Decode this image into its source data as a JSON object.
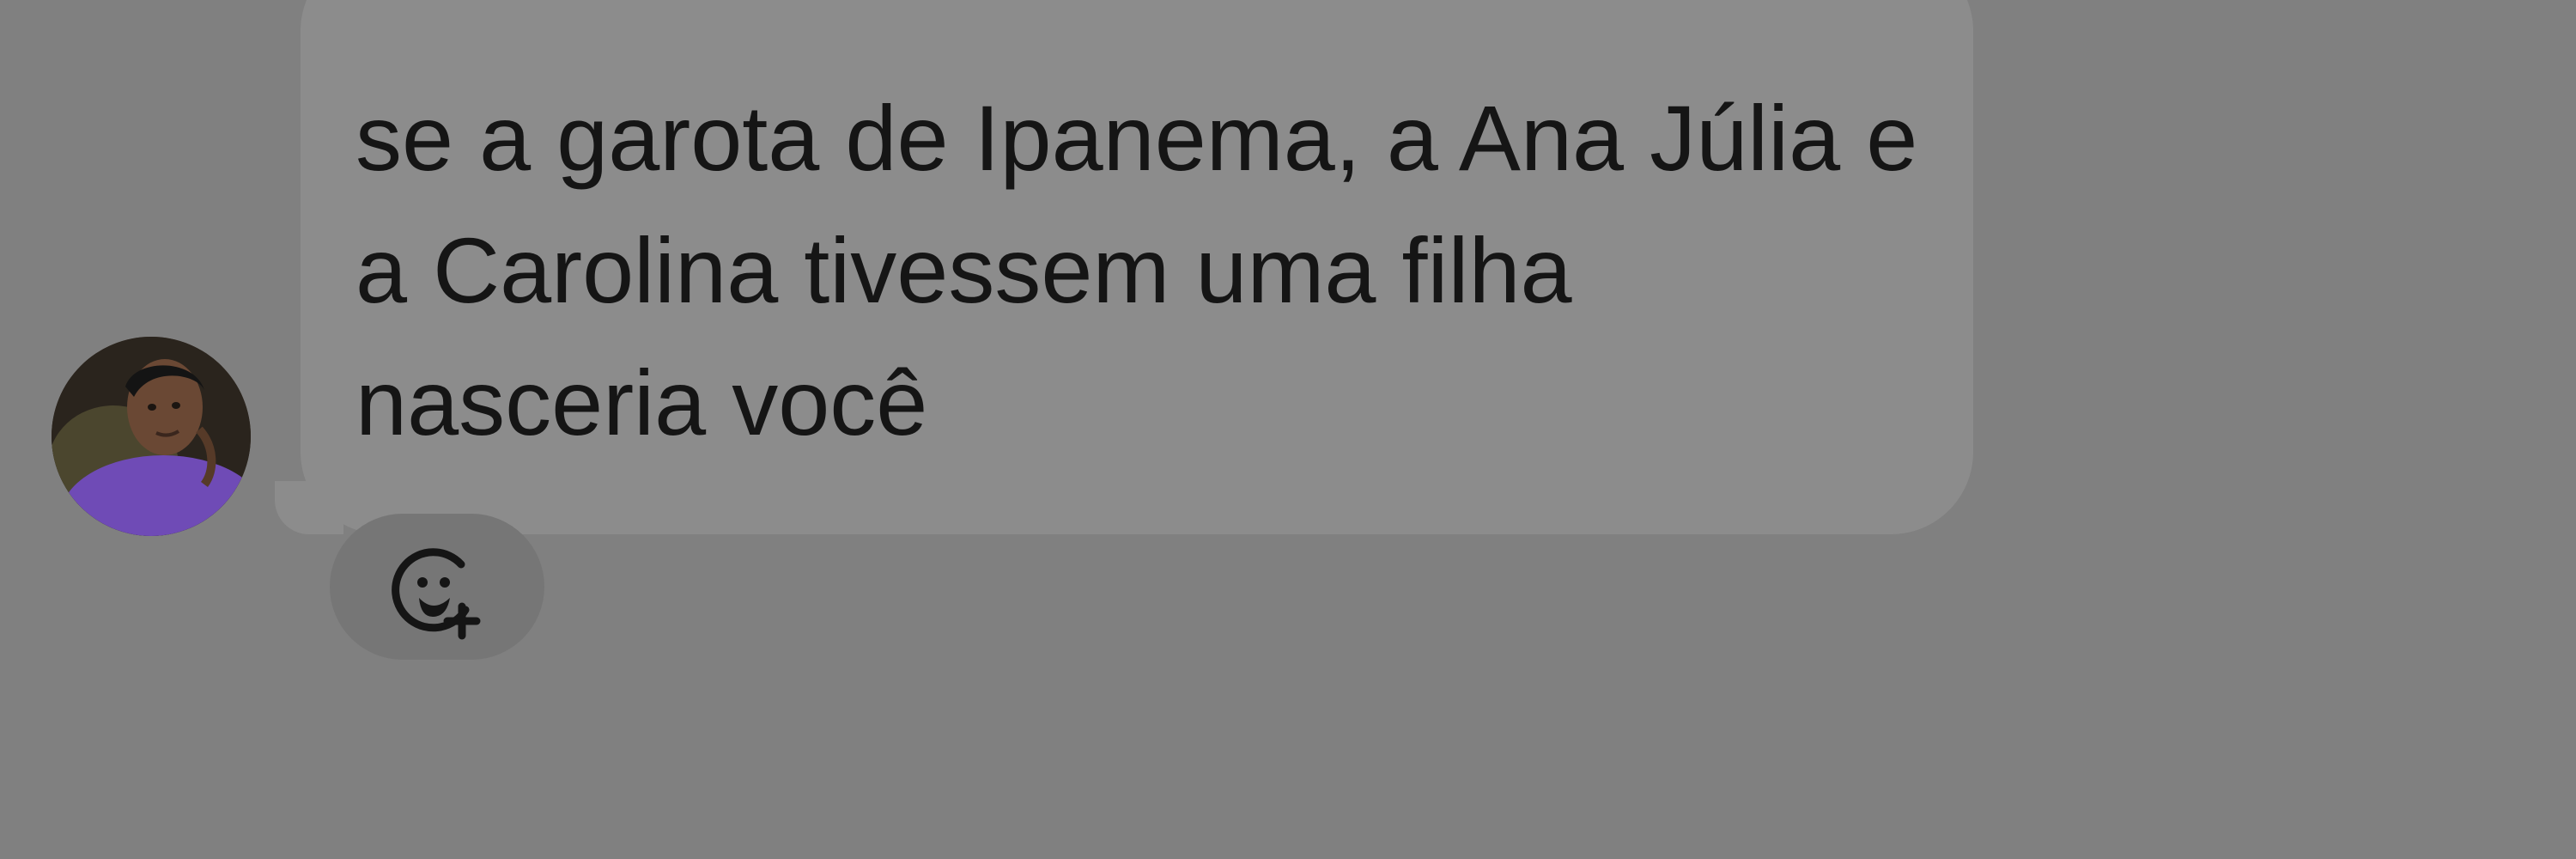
{
  "chat": {
    "message": {
      "text": "se a garota de Ipanema, a Ana Júlia e a Carolina tivessem uma filha nasceria você"
    },
    "avatar": {
      "icon": "profile-photo"
    },
    "reaction": {
      "icon": "add-reaction-icon"
    }
  },
  "colors": {
    "background": "#808080",
    "bubble": "#8c8c8c",
    "reaction_button": "#767676",
    "text": "#151515"
  }
}
